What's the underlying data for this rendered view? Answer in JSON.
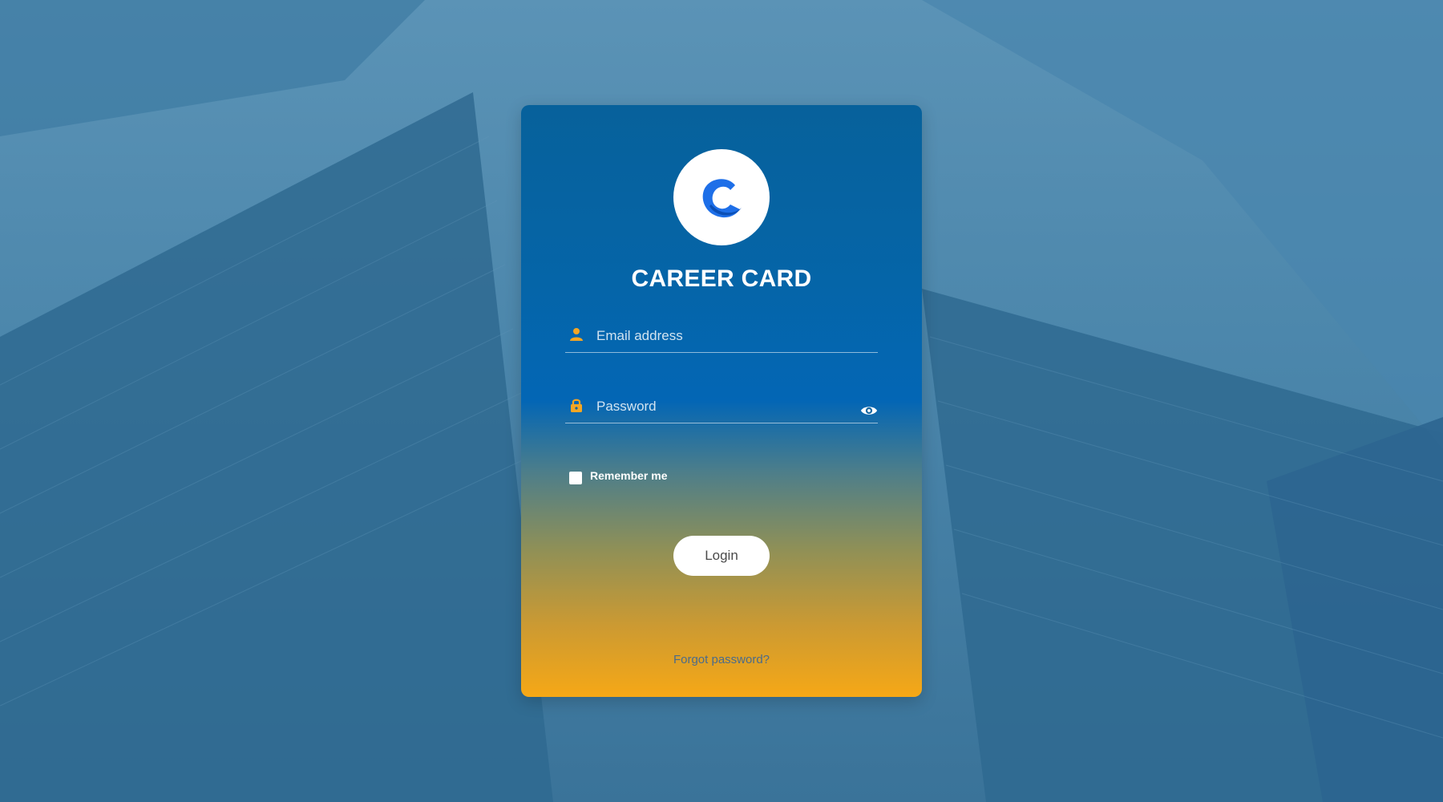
{
  "brand": {
    "name": "CAREER CARD",
    "logo_letter": "C",
    "logo_color": "#1e6fe8"
  },
  "form": {
    "email_placeholder": "Email address",
    "email_value": "",
    "password_placeholder": "Password",
    "password_value": "",
    "remember_label": "Remember me",
    "remember_checked": false,
    "login_label": "Login",
    "forgot_label": "Forgot password?"
  },
  "icons": {
    "email": "user-icon",
    "password": "lock-icon",
    "toggle_visibility": "eye-icon"
  },
  "colors": {
    "card_top": "#07619b",
    "card_bottom": "#f6a816",
    "icon_accent": "#f5a623",
    "background": "#4b86ab"
  }
}
